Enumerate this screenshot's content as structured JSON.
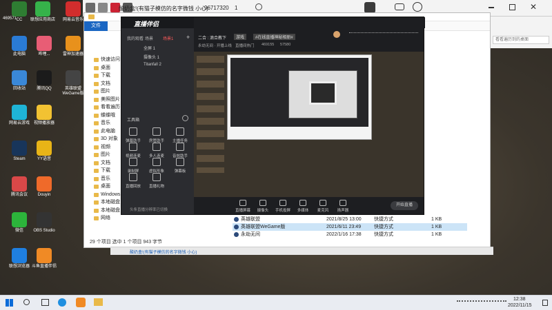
{
  "desktop": {
    "counter_label": "469571",
    "icons": [
      {
        "label": "CC",
        "color": "#2e7d32"
      },
      {
        "label": "联想应用商店",
        "color": "#36b24a"
      },
      {
        "label": "网易云音乐",
        "color": "#d22d2d"
      },
      {
        "label": "此电脑",
        "color": "#2a7bd5"
      },
      {
        "label": "哔哩...",
        "color": "#e85d75"
      },
      {
        "label": "雷神加速器",
        "color": "#e8911c"
      },
      {
        "label": "回收站",
        "color": "#3a88d8"
      },
      {
        "label": "腾讯QQ",
        "color": "#1b1b1b"
      },
      {
        "label": "英雄联盟WeGame版",
        "color": "#444"
      },
      {
        "label": "网易云游戏",
        "color": "#1fb4d6"
      },
      {
        "label": "视频播放器",
        "color": "#f2c232"
      },
      {
        "label": "Steam",
        "color": "#18355a"
      },
      {
        "label": "YY语音",
        "color": "#e8b417"
      },
      {
        "label": "腾讯会议",
        "color": "#d94848"
      },
      {
        "label": "Douyin",
        "color": "#ef6a2a"
      },
      {
        "label": "微信",
        "color": "#2cb43b"
      },
      {
        "label": "OBS Studio",
        "color": "#333"
      },
      {
        "label": "联想浏览器",
        "color": "#1f7fe0"
      },
      {
        "label": "斗鱼直播伴侣",
        "color": "#f08a25"
      }
    ]
  },
  "topbar": {
    "title": "酸奶盒!(有猫子模仿的名字微钱 小心)",
    "id": "96717320",
    "count": "1"
  },
  "explorer": {
    "file_tab": "文件",
    "nav_items": [
      "快速访问",
      "桌面",
      "下载",
      "文档",
      "图片",
      "美照图片",
      "看看遍历",
      "蝶蝶哦",
      "音乐",
      "此电脑",
      "3D 对象",
      "视频",
      "图片",
      "文档",
      "下载",
      "音乐",
      "桌面",
      "Windows",
      "本地磁盘 (D:)",
      "本地磁盘 (E:)",
      "网络"
    ],
    "files": [
      {
        "name": "英雄联盟",
        "date": "2021/8/25 13:00",
        "type": "快捷方式",
        "size": "1 KB"
      },
      {
        "name": "英雄联盟WeGame版",
        "date": "2021/6/11 23:49",
        "type": "快捷方式",
        "size": "1 KB"
      },
      {
        "name": "永劫无间",
        "date": "2022/1/16 17:38",
        "type": "快捷方式",
        "size": "1 KB"
      }
    ],
    "status": "29 个项目  选中 1 个项目  943 字节",
    "search_placeholder": "看看遍历到的桌面",
    "lower_title": "酸奶盒!(有猫子模仿的名字微钱 小心)"
  },
  "live_app": {
    "logo": "直播伴侣",
    "side_tabs": [
      "我的观看",
      "场景",
      "场景1"
    ],
    "scenes": [
      "全屏 1",
      "摄像头 1",
      "Titanfall 2"
    ],
    "tools_label": "工具箱",
    "tools": [
      "弹幕助手",
      "房管助手",
      "主播任务",
      "视频连麦",
      "多人连麦",
      "音效助手",
      "录制屏",
      "虚拟形象",
      "弹幕板",
      "直播回放",
      "直播礼物"
    ],
    "footer_note": "头条直播分辨率已切换",
    "header_title": "二合 : 滴合教下",
    "header_tags": [
      "游戏",
      "#在线直播神秘相册#"
    ],
    "header_line2": [
      "永劫无间 · 开播上线",
      "直播间热门",
      "469155",
      "57580"
    ],
    "bottom_tools": [
      "直播屏幕",
      "摄像头",
      "手机投屏",
      "多媒体",
      "麦克风",
      "扬声器"
    ],
    "start_button": "开始直播"
  },
  "taskbar": {
    "time": "12:38",
    "date": "2022/11/15"
  }
}
